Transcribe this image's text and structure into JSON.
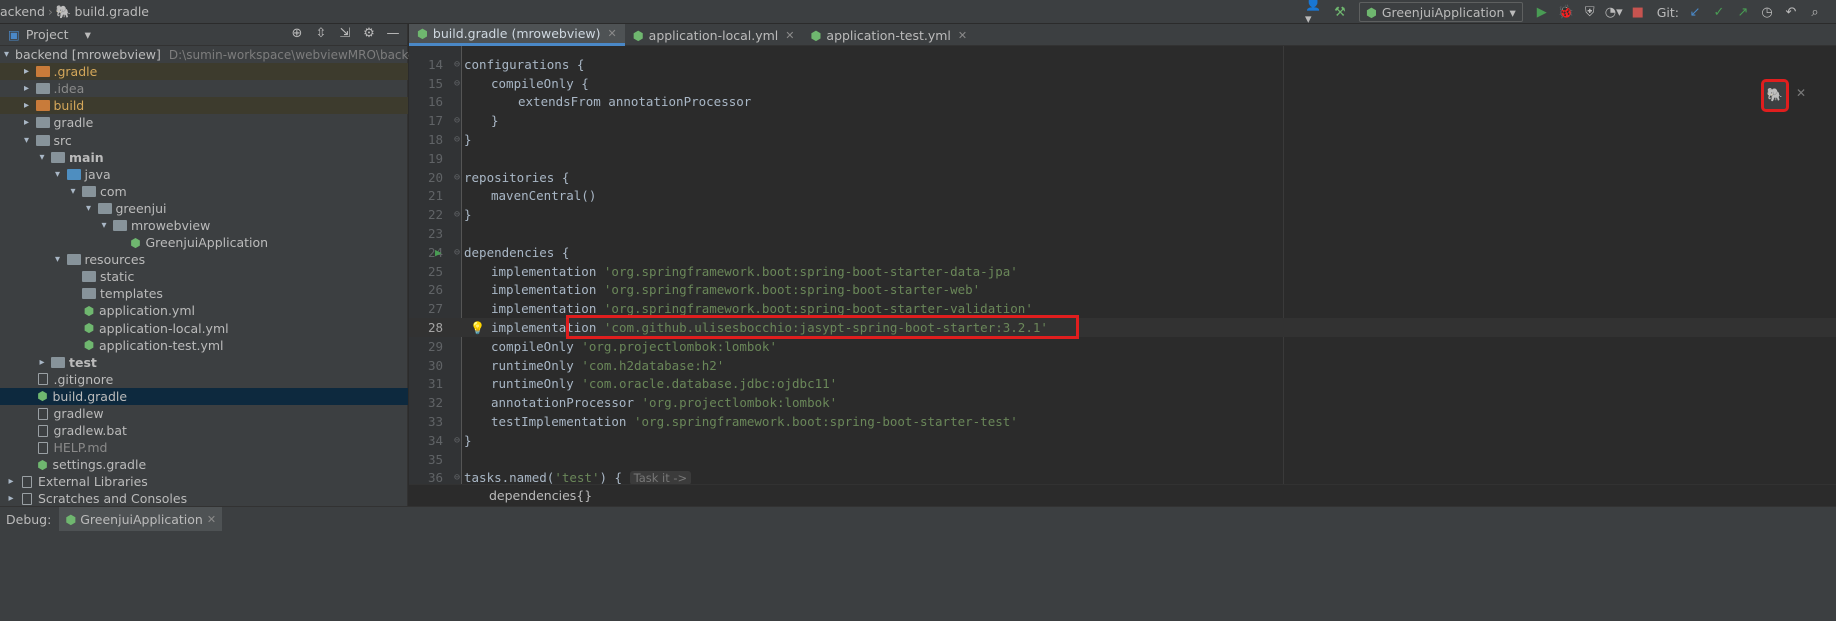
{
  "navbar": {
    "crumbs": [
      "ackend",
      "build.gradle"
    ],
    "run_config": "GreenjuiApplication",
    "git_label": "Git:"
  },
  "project_panel": {
    "title": "Project",
    "tree": [
      {
        "indent": 0,
        "arrow": "▾",
        "icon": "folder",
        "label": "backend [mrowebview]",
        "path": "D:\\sumin-workspace\\webviewMRO\\backend",
        "style": ""
      },
      {
        "indent": 1,
        "arrow": "▸",
        "icon": "orange",
        "label": ".gradle",
        "style": "orange",
        "row": "excluded"
      },
      {
        "indent": 1,
        "arrow": "▸",
        "icon": "folder",
        "label": ".idea",
        "style": "gray"
      },
      {
        "indent": 1,
        "arrow": "▸",
        "icon": "orange",
        "label": "build",
        "style": "orange",
        "row": "excluded"
      },
      {
        "indent": 1,
        "arrow": "▸",
        "icon": "folder",
        "label": "gradle",
        "style": ""
      },
      {
        "indent": 1,
        "arrow": "▾",
        "icon": "folder",
        "label": "src",
        "style": ""
      },
      {
        "indent": 2,
        "arrow": "▾",
        "icon": "folder",
        "label": "main",
        "style": "bold"
      },
      {
        "indent": 3,
        "arrow": "▾",
        "icon": "blue",
        "label": "java",
        "style": ""
      },
      {
        "indent": 4,
        "arrow": "▾",
        "icon": "folder",
        "label": "com",
        "style": ""
      },
      {
        "indent": 5,
        "arrow": "▾",
        "icon": "folder",
        "label": "greenjui",
        "style": ""
      },
      {
        "indent": 6,
        "arrow": "▾",
        "icon": "folder",
        "label": "mrowebview",
        "style": ""
      },
      {
        "indent": 7,
        "arrow": "",
        "icon": "gradle",
        "label": "GreenjuiApplication",
        "style": ""
      },
      {
        "indent": 3,
        "arrow": "▾",
        "icon": "res",
        "label": "resources",
        "style": ""
      },
      {
        "indent": 4,
        "arrow": "",
        "icon": "folder",
        "label": "static",
        "style": ""
      },
      {
        "indent": 4,
        "arrow": "",
        "icon": "folder",
        "label": "templates",
        "style": ""
      },
      {
        "indent": 4,
        "arrow": "",
        "icon": "gradle",
        "label": "application.yml",
        "style": ""
      },
      {
        "indent": 4,
        "arrow": "",
        "icon": "gradle",
        "label": "application-local.yml",
        "style": ""
      },
      {
        "indent": 4,
        "arrow": "",
        "icon": "gradle",
        "label": "application-test.yml",
        "style": ""
      },
      {
        "indent": 2,
        "arrow": "▸",
        "icon": "folder",
        "label": "test",
        "style": "bold"
      },
      {
        "indent": 1,
        "arrow": "",
        "icon": "file",
        "label": ".gitignore",
        "style": ""
      },
      {
        "indent": 1,
        "arrow": "",
        "icon": "gradle",
        "label": "build.gradle",
        "style": "",
        "row": "selected"
      },
      {
        "indent": 1,
        "arrow": "",
        "icon": "file",
        "label": "gradlew",
        "style": ""
      },
      {
        "indent": 1,
        "arrow": "",
        "icon": "file",
        "label": "gradlew.bat",
        "style": ""
      },
      {
        "indent": 1,
        "arrow": "",
        "icon": "file",
        "label": "HELP.md",
        "style": "gray"
      },
      {
        "indent": 1,
        "arrow": "",
        "icon": "gradle",
        "label": "settings.gradle",
        "style": ""
      },
      {
        "indent": 0,
        "arrow": "▸",
        "icon": "file",
        "label": "External Libraries",
        "style": ""
      },
      {
        "indent": 0,
        "arrow": "▸",
        "icon": "file",
        "label": "Scratches and Consoles",
        "style": ""
      }
    ]
  },
  "editor_tabs": [
    {
      "label": "build.gradle (mrowebview)",
      "active": true
    },
    {
      "label": "application-local.yml",
      "active": false
    },
    {
      "label": "application-test.yml",
      "active": false
    }
  ],
  "code_lines": [
    {
      "n": "14",
      "indent": 0,
      "parts": [
        [
          "t",
          "configurations {"
        ]
      ],
      "mark": "fold"
    },
    {
      "n": "15",
      "indent": 1,
      "parts": [
        [
          "t",
          "compileOnly {"
        ]
      ],
      "mark": "fold"
    },
    {
      "n": "16",
      "indent": 2,
      "parts": [
        [
          "t",
          "extendsFrom annotationProcessor"
        ]
      ]
    },
    {
      "n": "17",
      "indent": 1,
      "parts": [
        [
          "t",
          "}"
        ]
      ],
      "mark": "fold"
    },
    {
      "n": "18",
      "indent": 0,
      "parts": [
        [
          "t",
          "}"
        ]
      ],
      "mark": "fold"
    },
    {
      "n": "19",
      "indent": 0,
      "parts": []
    },
    {
      "n": "20",
      "indent": 0,
      "parts": [
        [
          "t",
          "repositories {"
        ]
      ],
      "mark": "fold"
    },
    {
      "n": "21",
      "indent": 1,
      "parts": [
        [
          "t",
          "mavenCentral()"
        ]
      ]
    },
    {
      "n": "22",
      "indent": 0,
      "parts": [
        [
          "t",
          "}"
        ]
      ],
      "mark": "fold"
    },
    {
      "n": "23",
      "indent": 0,
      "parts": []
    },
    {
      "n": "24",
      "indent": 0,
      "parts": [
        [
          "t",
          "dependencies {"
        ]
      ],
      "mark": "fold",
      "run": true
    },
    {
      "n": "25",
      "indent": 1,
      "parts": [
        [
          "t",
          "implementation "
        ],
        [
          "s",
          "'org.springframework.boot:spring-boot-starter-data-jpa'"
        ]
      ]
    },
    {
      "n": "26",
      "indent": 1,
      "parts": [
        [
          "t",
          "implementation "
        ],
        [
          "s",
          "'org.springframework.boot:spring-boot-starter-web'"
        ]
      ]
    },
    {
      "n": "27",
      "indent": 1,
      "parts": [
        [
          "t",
          "implementation "
        ],
        [
          "s",
          "'org.springframework.boot:spring-boot-starter-validation'"
        ]
      ]
    },
    {
      "n": "28",
      "indent": 1,
      "parts": [
        [
          "t",
          "implementation "
        ],
        [
          "s",
          "'com.github.ulisesbocchio:jasypt-spring-boot-starter:3.2.1'"
        ]
      ],
      "current": true,
      "bulb": true
    },
    {
      "n": "29",
      "indent": 1,
      "parts": [
        [
          "t",
          "compileOnly "
        ],
        [
          "s",
          "'org.projectlombok:lombok'"
        ]
      ]
    },
    {
      "n": "30",
      "indent": 1,
      "parts": [
        [
          "t",
          "runtimeOnly "
        ],
        [
          "s",
          "'com.h2database:h2'"
        ]
      ]
    },
    {
      "n": "31",
      "indent": 1,
      "parts": [
        [
          "t",
          "runtimeOnly "
        ],
        [
          "s",
          "'com.oracle.database.jdbc:ojdbc11'"
        ]
      ]
    },
    {
      "n": "32",
      "indent": 1,
      "parts": [
        [
          "t",
          "annotationProcessor "
        ],
        [
          "s",
          "'org.projectlombok:lombok'"
        ]
      ]
    },
    {
      "n": "33",
      "indent": 1,
      "parts": [
        [
          "t",
          "testImplementation "
        ],
        [
          "s",
          "'org.springframework.boot:spring-boot-starter-test'"
        ]
      ]
    },
    {
      "n": "34",
      "indent": 0,
      "parts": [
        [
          "t",
          "}"
        ]
      ],
      "mark": "fold"
    },
    {
      "n": "35",
      "indent": 0,
      "parts": []
    },
    {
      "n": "36",
      "indent": 0,
      "parts": [
        [
          "t",
          "tasks.named("
        ],
        [
          "s",
          "'test'"
        ],
        [
          "t",
          ") { "
        ],
        [
          "h",
          "Task it ->"
        ]
      ],
      "mark": "fold"
    }
  ],
  "editor_breadcrumb": "dependencies{}",
  "debug": {
    "label": "Debug:",
    "tab": "GreenjuiApplication"
  },
  "colors": {
    "accent": "#4a88c7",
    "highlight_red": "#e01e1e"
  }
}
